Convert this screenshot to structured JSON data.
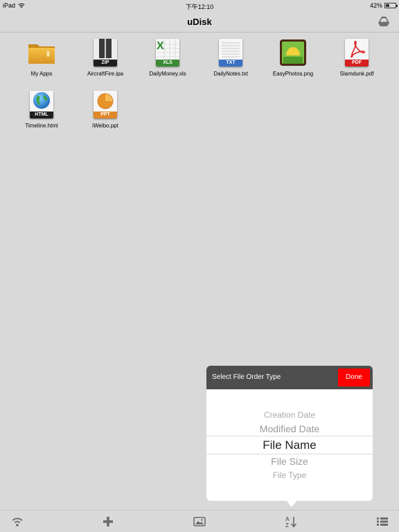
{
  "status_bar": {
    "device": "iPad",
    "time": "下午12:10",
    "battery": "42%",
    "battery_level": 0.42
  },
  "nav": {
    "title": "uDisk",
    "right_icon": "drive-icon"
  },
  "files": [
    {
      "name": "My Apps",
      "icon": "folder-icon",
      "tag": ""
    },
    {
      "name": "AircraftFire.ipa",
      "icon": "zip-icon",
      "tag": "ZIP"
    },
    {
      "name": "DailyMoney.xls",
      "icon": "xls-icon",
      "tag": "XLS"
    },
    {
      "name": "DailyNotes.txt",
      "icon": "txt-icon",
      "tag": "TXT"
    },
    {
      "name": "EasyPhotos.png",
      "icon": "image-icon",
      "tag": ""
    },
    {
      "name": "Slamdunk.pdf",
      "icon": "pdf-icon",
      "tag": "PDF"
    },
    {
      "name": "Timeline.html",
      "icon": "html-icon",
      "tag": "HTML"
    },
    {
      "name": "iWeibo.ppt",
      "icon": "ppt-icon",
      "tag": "PPT"
    }
  ],
  "sort_popover": {
    "title": "Select File Order Type",
    "done_label": "Done",
    "options": [
      "Creation Date",
      "Modified Date",
      "File Name",
      "File Size",
      "File Type"
    ],
    "selected": "File Name"
  },
  "tab_bar": {
    "items": [
      "wifi-icon",
      "add-icon",
      "photo-icon",
      "sort-az-icon",
      "list-icon"
    ]
  },
  "colors": {
    "background": "#d9d9d9",
    "done": "#ff0000",
    "popover_header": "#4d4d4d",
    "icon_gray": "#6b6b6b"
  }
}
